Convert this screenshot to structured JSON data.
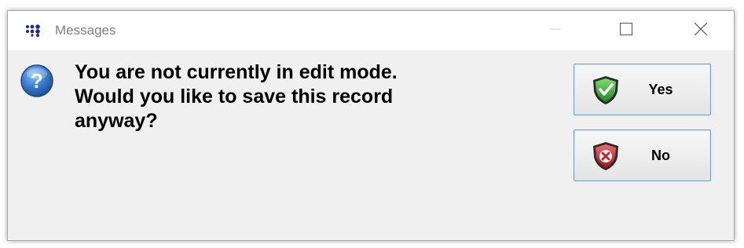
{
  "window": {
    "title": "Messages",
    "title_color": "#7f7f7f",
    "background": "#f0f0f0"
  },
  "titlebar_buttons": [
    {
      "name": "minimize",
      "icon": "minimize-icon"
    },
    {
      "name": "maximize",
      "icon": "maximize-icon"
    },
    {
      "name": "close",
      "icon": "close-icon"
    }
  ],
  "dialog": {
    "icon": "question-icon",
    "message": "You are not currently in edit mode.\nWould you like to save this record\nanyway?"
  },
  "buttons": {
    "yes": {
      "label": "Yes",
      "icon": "green-shield-check-icon",
      "accent": "#2e9e3a"
    },
    "no": {
      "label": "No",
      "icon": "red-shield-x-icon",
      "accent": "#c8202a"
    }
  },
  "colors": {
    "button_border": "#6f9fd3",
    "question_icon": "#3b7fd0"
  }
}
